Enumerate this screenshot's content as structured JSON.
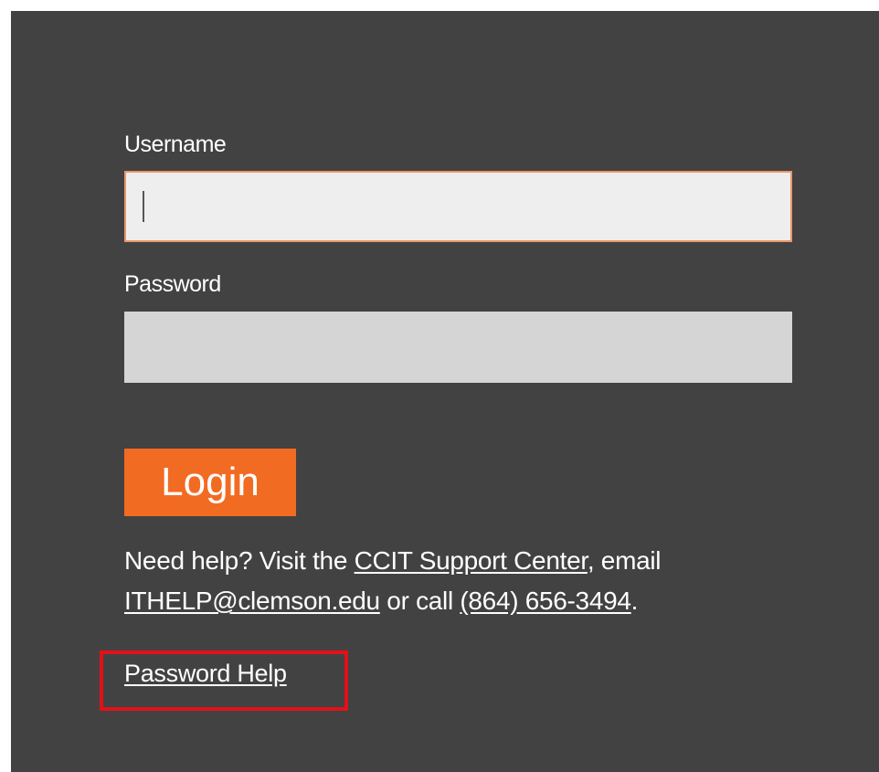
{
  "form": {
    "username_label": "Username",
    "username_value": "",
    "password_label": "Password",
    "password_value": "",
    "login_label": "Login"
  },
  "help": {
    "prefix": "Need help? Visit the ",
    "support_link": "CCIT Support Center",
    "mid1": ", email ",
    "email_link": "ITHELP@clemson.edu",
    "mid2": " or call ",
    "phone_link": "(864) 656-3494",
    "suffix": ".",
    "password_help_link": "Password Help"
  },
  "colors": {
    "panel_bg": "#424242",
    "accent": "#f26b22",
    "highlight": "#e3101a"
  }
}
